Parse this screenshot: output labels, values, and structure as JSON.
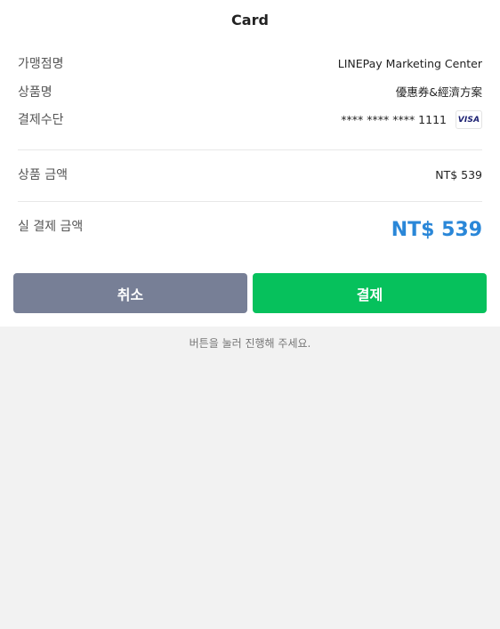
{
  "header": {
    "title": "Card"
  },
  "details": {
    "merchant_label": "가맹점명",
    "merchant_value": "LINEPay Marketing Center",
    "product_label": "상품명",
    "product_value": "優惠券&經濟方案",
    "method_label": "결제수단",
    "card_number": "**** **** **** 1111",
    "card_brand": "VISA",
    "card_brand_icon": "visa-logo",
    "amount_label": "상품 금액",
    "amount_value": "NT$ 539",
    "final_label": "실 결제 금액",
    "final_value": "NT$ 539"
  },
  "actions": {
    "cancel_label": "취소",
    "pay_label": "결제"
  },
  "footer": {
    "hint": "버튼을 눌러 진행해 주세요."
  },
  "colors": {
    "pay_button": "#06c15c",
    "cancel_button": "#777f96",
    "final_amount": "#2a87d8",
    "page_background": "#f2f2f2"
  }
}
